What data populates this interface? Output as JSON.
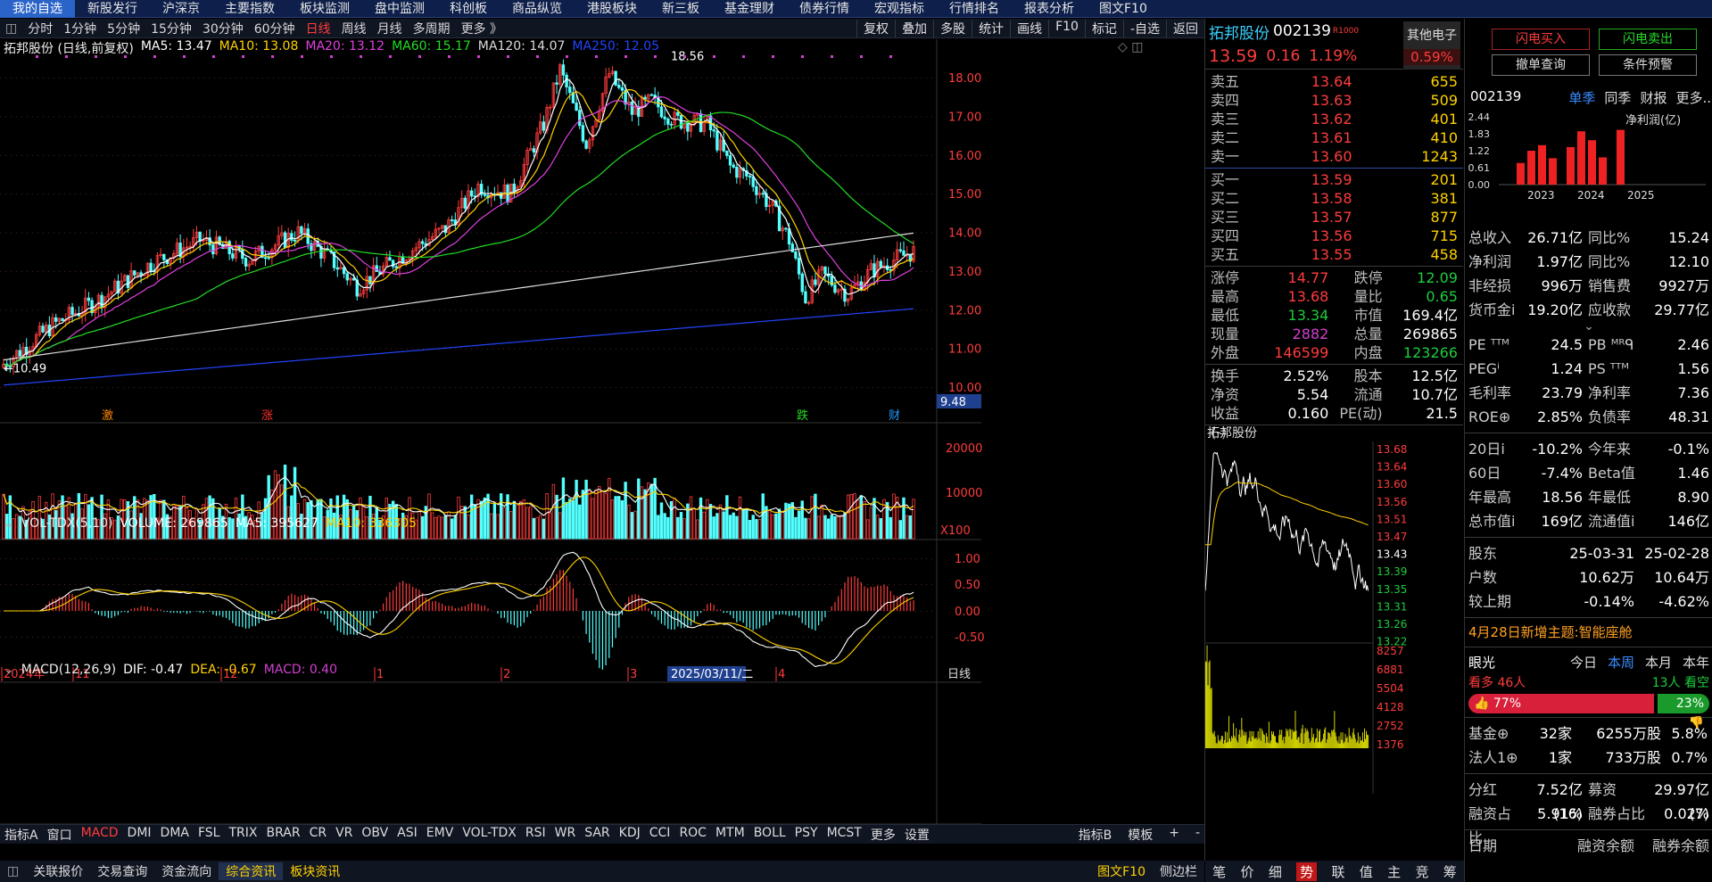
{
  "topbar": {
    "tabs": [
      "我的自选",
      "新股发行",
      "沪深京",
      "主要指数",
      "板块监测",
      "盘中监测",
      "科创板",
      "商品纵览",
      "港股板块",
      "新三板",
      "基金理财",
      "债券行情",
      "宏观指标",
      "行情排名",
      "报表分析",
      "图文F10"
    ]
  },
  "period": {
    "items": [
      "分时",
      "1分钟",
      "5分钟",
      "15分钟",
      "30分钟",
      "60分钟",
      "日线",
      "周线",
      "月线",
      "多周期",
      "更多 》"
    ],
    "active": "日线",
    "right": [
      "复权",
      "叠加",
      "多股",
      "统计",
      "画线",
      "F10",
      "标记",
      "-自选",
      "返回"
    ]
  },
  "main": {
    "title": "拓邦股份 (日线,前复权)",
    "ma": [
      {
        "label": "MA5: 13.47",
        "color": "#ffffff"
      },
      {
        "label": "MA10: 13.08",
        "color": "#ffd200"
      },
      {
        "label": "MA20: 13.12",
        "color": "#e040e0"
      },
      {
        "label": "MA60: 15.17",
        "color": "#22dd22"
      },
      {
        "label": "MA120: 14.07",
        "color": "#dddddd"
      },
      {
        "label": "MA250: 12.05",
        "color": "#2244ff"
      }
    ],
    "yticks": [
      "18.00",
      "17.00",
      "16.00",
      "15.00",
      "14.00",
      "13.00",
      "12.00",
      "11.00",
      "10.00"
    ],
    "high_label": "18.56",
    "low_label": "10.49",
    "cursor_price": "9.48",
    "markers": [
      {
        "t": "激",
        "c": "#ff8800",
        "x": 114
      },
      {
        "t": "涨",
        "c": "#ff3030",
        "x": 293
      },
      {
        "t": "跌",
        "c": "#22dd22",
        "x": 893
      },
      {
        "t": "财",
        "c": "#2299ff",
        "x": 996
      }
    ]
  },
  "volume": {
    "title": "VOL-TDX(5,10)",
    "vol": "VOLUME: 269865",
    "ma5": "MA5: 395627",
    "ma10": "MA10: 336305",
    "yticks": [
      "20000",
      "10000"
    ],
    "unit": "X100"
  },
  "macd": {
    "title": "MACD(12,26,9)",
    "dif": "DIF: -0.47",
    "dea": "DEA: -0.67",
    "macd": "MACD: 0.40",
    "yticks": [
      "1.00",
      "0.50",
      "0.00",
      "-0.50"
    ]
  },
  "xaxis": {
    "labels": [
      "2024年",
      "11",
      "12",
      "1",
      "2",
      "3",
      "2025/03/11/二",
      "4"
    ],
    "right": "日线"
  },
  "indicators": {
    "left": "指标A",
    "items": [
      "窗口",
      "MACD",
      "DMI",
      "DMA",
      "FSL",
      "TRIX",
      "BRAR",
      "CR",
      "VR",
      "OBV",
      "ASI",
      "EMV",
      "VOL-TDX",
      "RSI",
      "WR",
      "SAR",
      "KDJ",
      "CCI",
      "ROC",
      "MTM",
      "BOLL",
      "PSY",
      "MCST",
      "更多",
      "设置"
    ],
    "active": "MACD",
    "right": [
      "指标B",
      "模板",
      "+",
      "-"
    ]
  },
  "status": {
    "items": [
      "关联报价",
      "交易查询",
      "资金流向",
      "综合资讯",
      "板块资讯"
    ],
    "active": "综合资讯",
    "right": [
      "图文F10",
      "侧边栏"
    ]
  },
  "quote": {
    "name": "拓邦股份",
    "code": "002139",
    "tag": "R1000",
    "price": "13.59",
    "change": "0.16",
    "pct": "1.19%",
    "sector": "其他电子",
    "sector_pct": "0.59%",
    "asks": [
      [
        "卖五",
        "13.64",
        "655"
      ],
      [
        "卖四",
        "13.63",
        "509"
      ],
      [
        "卖三",
        "13.62",
        "401"
      ],
      [
        "卖二",
        "13.61",
        "410"
      ],
      [
        "卖一",
        "13.60",
        "1243"
      ]
    ],
    "bids": [
      [
        "买一",
        "13.59",
        "201"
      ],
      [
        "买二",
        "13.58",
        "381"
      ],
      [
        "买三",
        "13.57",
        "877"
      ],
      [
        "买四",
        "13.56",
        "715"
      ],
      [
        "买五",
        "13.55",
        "458"
      ]
    ],
    "stats": [
      [
        "涨停",
        "14.77",
        "跌停",
        "12.09"
      ],
      [
        "最高",
        "13.68",
        "量比",
        "0.65"
      ],
      [
        "最低",
        "13.34",
        "市值",
        "169.4亿"
      ],
      [
        "现量",
        "2882",
        "总量",
        "269865"
      ],
      [
        "外盘",
        "146599",
        "内盘",
        "123266"
      ]
    ],
    "stats2": [
      [
        "换手",
        "2.52%",
        "股本",
        "12.5亿"
      ],
      [
        "净资",
        "5.54",
        "流通",
        "10.7亿"
      ],
      [
        "收益(-)",
        "0.160",
        "PE(动)",
        "21.5"
      ]
    ]
  },
  "mini": {
    "title": "拓邦股份",
    "ticks": [
      "13.68",
      "13.64",
      "13.60",
      "13.56",
      "13.51",
      "13.47",
      "13.43",
      "13.39",
      "13.35",
      "13.31",
      "13.26",
      "13.22",
      "8257",
      "6881",
      "5504",
      "4128",
      "2752",
      "1376"
    ],
    "tabs": [
      "笔",
      "价",
      "细",
      "势",
      "联",
      "值",
      "主",
      "竞",
      "筹"
    ],
    "active": "势"
  },
  "f10": {
    "buttons": [
      "闪电买入",
      "闪电卖出",
      "撤单查询",
      "条件预警"
    ],
    "code": "002139",
    "tabs": [
      "单季",
      "同季",
      "财报",
      "更多.."
    ],
    "chart_label": "净利润(亿)",
    "yticks": [
      "2.44",
      "1.83",
      "1.22",
      "0.61",
      "0.00"
    ],
    "xticks": [
      "2023",
      "2024",
      "2025"
    ],
    "chart_data": {
      "type": "bar",
      "values": [
        0.78,
        1.22,
        1.42,
        0.95,
        1.35,
        1.92,
        1.6,
        0.98,
        1.97
      ],
      "ylim": [
        0,
        2.44
      ]
    },
    "rows": [
      [
        "总收入",
        "26.71亿",
        "同比%",
        "15.24"
      ],
      [
        "净利润",
        "1.97亿",
        "同比%",
        "12.10"
      ],
      [
        "非经损",
        "996万",
        "销售费",
        "9927万"
      ],
      [
        "货币金i",
        "19.20亿",
        "应收款",
        "29.77亿"
      ]
    ],
    "rows2": [
      [
        "PE ᵀᵀᴹ",
        "24.5",
        "PB ᴹᴿᑫ",
        "2.46"
      ],
      [
        "PEGⁱ",
        "1.24",
        "PS ᵀᵀᴹ",
        "1.56"
      ],
      [
        "毛利率",
        "23.79",
        "净利率",
        "7.36"
      ],
      [
        "ROE⊕",
        "2.85%",
        "负债率",
        "48.31"
      ]
    ],
    "rows3": [
      [
        "20日i",
        "-10.2%",
        "今年来",
        "-0.1%"
      ],
      [
        "60日",
        "-7.4%",
        "Beta值",
        "1.46"
      ],
      [
        "年最高",
        "18.56",
        "年最低",
        "8.90"
      ],
      [
        "总市值i",
        "169亿",
        "流通值i",
        "146亿"
      ]
    ],
    "holder_head": [
      "股东",
      "25-03-31",
      "25-02-28"
    ],
    "holders": [
      [
        "户数",
        "10.62万",
        "10.64万"
      ],
      [
        "较上期",
        "-0.14%",
        "-4.62%"
      ]
    ],
    "theme": "4月28日新增主题:智能座舱",
    "eye": {
      "label": "眼光",
      "tabs": [
        "今日",
        "本周",
        "本月",
        "本年"
      ],
      "active": "本周",
      "bull": "看多 46人",
      "bear": "13人 看空",
      "bull_pct": "77%",
      "bear_pct": "23%",
      "bull_frac": 0.77
    },
    "inst": [
      [
        "基金⊕",
        "32家",
        "6255万股",
        "5.8%"
      ],
      [
        "法人1⊕",
        "1家",
        "733万股",
        "0.7%"
      ]
    ],
    "div": [
      "分红",
      "7.52亿(16)",
      "募资",
      "29.97亿(7)"
    ],
    "margin": [
      "融资占比",
      "5.91%",
      "融券占比",
      "0.02%"
    ],
    "bottom": [
      "日期",
      "融资余额",
      "融券余额"
    ]
  }
}
